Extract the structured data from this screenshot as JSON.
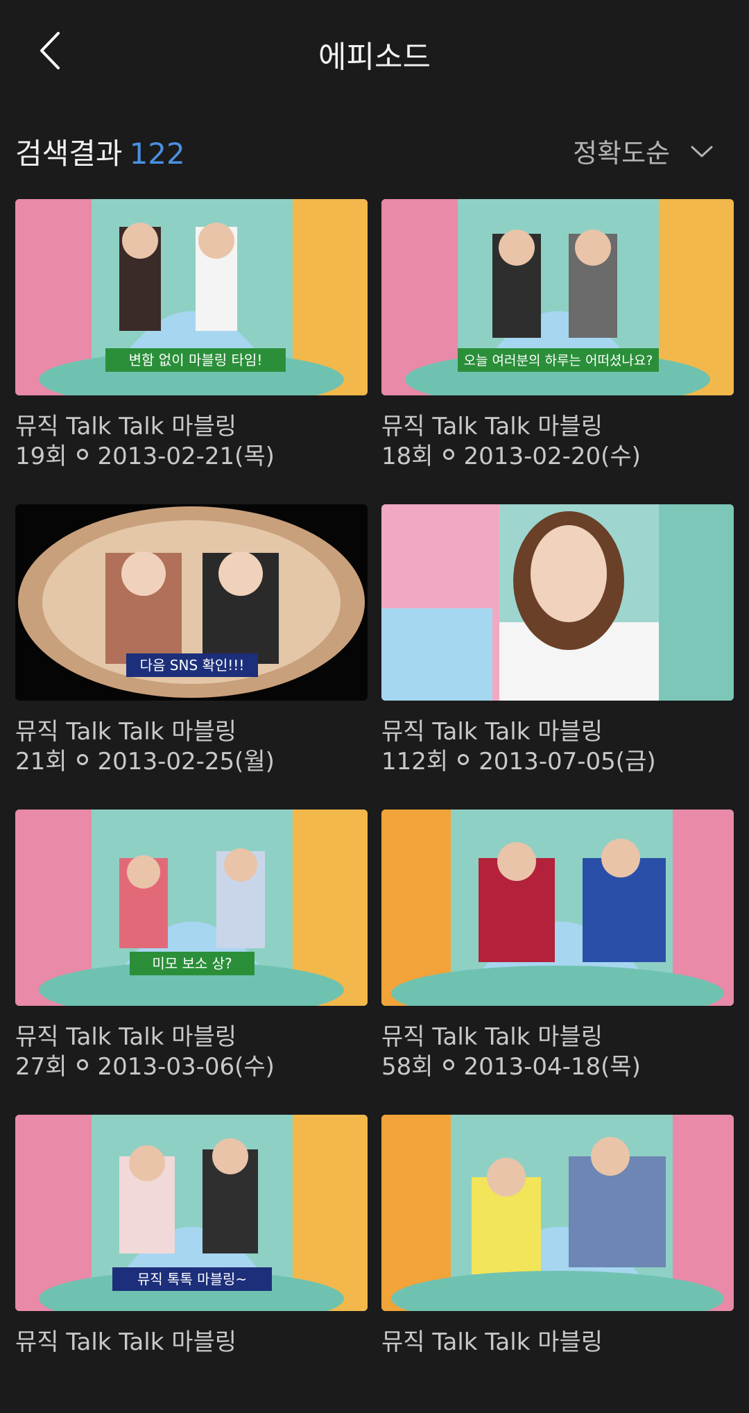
{
  "header": {
    "title": "에피소드"
  },
  "results": {
    "label": "검색결과",
    "count": "122"
  },
  "sort": {
    "label": "정확도순"
  },
  "episodes": [
    {
      "title": "뮤직 Talk Talk 마블링",
      "episode": "19회",
      "date": "2013-02-21(목)",
      "caption": "변함 없이 마블링 타임!"
    },
    {
      "title": "뮤직 Talk Talk 마블링",
      "episode": "18회",
      "date": "2013-02-20(수)",
      "caption": "오늘 여러분의 하루는 어떠셨나요?"
    },
    {
      "title": "뮤직 Talk Talk 마블링",
      "episode": "21회",
      "date": "2013-02-25(월)",
      "caption": "다음 SNS 확인!!!"
    },
    {
      "title": "뮤직 Talk Talk 마블링",
      "episode": "112회",
      "date": "2013-07-05(금)",
      "caption": ""
    },
    {
      "title": "뮤직 Talk Talk 마블링",
      "episode": "27회",
      "date": "2013-03-06(수)",
      "caption": "미모 보소 상?"
    },
    {
      "title": "뮤직 Talk Talk 마블링",
      "episode": "58회",
      "date": "2013-04-18(목)",
      "caption": ""
    },
    {
      "title": "뮤직 Talk Talk 마블링",
      "episode": "",
      "date": "",
      "caption": "뮤직 톡톡 마블링~"
    },
    {
      "title": "뮤직 Talk Talk 마블링",
      "episode": "",
      "date": "",
      "caption": ""
    }
  ]
}
